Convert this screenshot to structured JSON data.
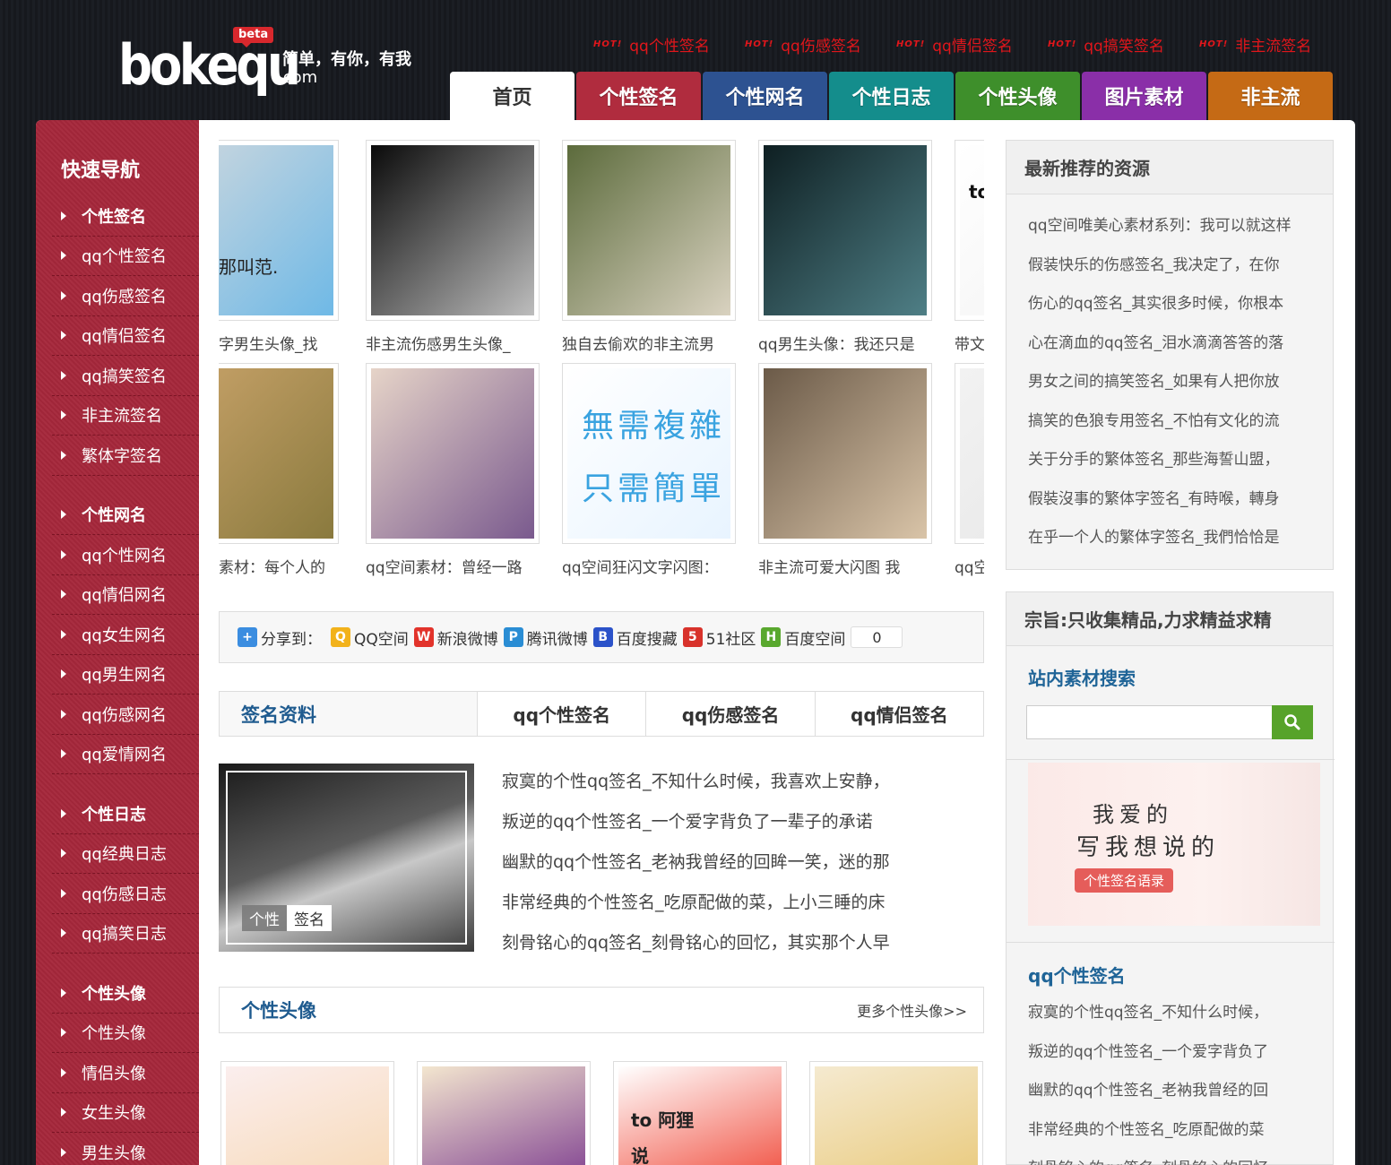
{
  "header": {
    "logo_text": "bokequ",
    "logo_badge": "beta",
    "logo_slogan": "简单，有你，有我",
    "logo_domain": ".com",
    "hot_badge": "HOT!",
    "hot_links": [
      "qq个性签名",
      "qq伤感签名",
      "qq情侣签名",
      "qq搞笑签名",
      "非主流签名"
    ]
  },
  "nav": {
    "tabs": [
      {
        "label": "首页",
        "color": "#ffffff"
      },
      {
        "label": "个性签名",
        "color": "#b02c3e"
      },
      {
        "label": "个性网名",
        "color": "#2d5291"
      },
      {
        "label": "个性日志",
        "color": "#148d8c"
      },
      {
        "label": "个性头像",
        "color": "#3e8f2b"
      },
      {
        "label": "图片素材",
        "color": "#8a2fa8"
      },
      {
        "label": "非主流",
        "color": "#c56a15"
      }
    ]
  },
  "sidebar": {
    "title": "快速导航",
    "groups": [
      {
        "head": "个性签名",
        "items": [
          "qq个性签名",
          "qq伤感签名",
          "qq情侣签名",
          "qq搞笑签名",
          "非主流签名",
          "繁体字签名"
        ]
      },
      {
        "head": "个性网名",
        "items": [
          "qq个性网名",
          "qq情侣网名",
          "qq女生网名",
          "qq男生网名",
          "qq伤感网名",
          "qq爱情网名"
        ]
      },
      {
        "head": "个性日志",
        "items": [
          "qq经典日志",
          "qq伤感日志",
          "qq搞笑日志"
        ]
      },
      {
        "head": "个性头像",
        "items": [
          "个性头像",
          "情侣头像",
          "女生头像",
          "男生头像"
        ]
      }
    ]
  },
  "gallery": {
    "row1": [
      {
        "caption": "字男生头像_找",
        "overlay": "二逼那叫范.",
        "color1": "#cfd8de",
        "color2": "#6fb9e6"
      },
      {
        "caption": "非主流伤感男生头像_",
        "color1": "#0a0a0a",
        "color2": "#bdbdbd"
      },
      {
        "caption": "独自去偷欢的非主流男",
        "color1": "#5c6b3c",
        "color2": "#d9d2c0"
      },
      {
        "caption": "qq男生头像：我还只是",
        "color1": "#0e1f22",
        "color2": "#4f7f86"
      },
      {
        "caption": "带文字",
        "overlay": "to",
        "color1": "#ffffff",
        "color2": "#f2f2f2"
      }
    ],
    "row2": [
      {
        "caption": "素材：每个人的",
        "color1": "#c9a36a",
        "color2": "#8a7a3e"
      },
      {
        "caption": "qq空间素材：曾经一路",
        "color1": "#e6d4c8",
        "color2": "#7a5a8e"
      },
      {
        "caption": "qq空间狂闪文字闪图：",
        "overlay": "無需複雜 只需簡單",
        "color1": "#ffffff",
        "color2": "#e8f4ff"
      },
      {
        "caption": "非主流可爱大闪图 我",
        "color1": "#6b5a48",
        "color2": "#d9c4a8"
      },
      {
        "caption": "qq空间",
        "color1": "#f2f2f2",
        "color2": "#e6e6e6"
      }
    ]
  },
  "share": {
    "label": "分享到：",
    "items": [
      {
        "name": "QQ空间",
        "icon": "qzone-icon",
        "color": "#f2b21b",
        "glyph": "Q"
      },
      {
        "name": "新浪微博",
        "icon": "weibo-icon",
        "color": "#e2332b",
        "glyph": "W"
      },
      {
        "name": "腾讯微博",
        "icon": "tencent-weibo-icon",
        "color": "#2a8dd4",
        "glyph": "P"
      },
      {
        "name": "百度搜藏",
        "icon": "baidu-icon",
        "color": "#2b52c9",
        "glyph": "B"
      },
      {
        "name": "51社区",
        "icon": "51-icon",
        "color": "#d8322b",
        "glyph": "5"
      },
      {
        "name": "百度空间",
        "icon": "baidu-space-icon",
        "color": "#59a82e",
        "glyph": "H"
      }
    ],
    "count": "0"
  },
  "sign_section": {
    "title": "签名资料",
    "tabs": [
      "qq个性签名",
      "qq伤感签名",
      "qq情侣签名"
    ],
    "image_tag_1": "个性",
    "image_tag_2": "签名",
    "lines": [
      "寂寞的个性qq签名_不知什么时候，我喜欢上安静，",
      "叛逆的qq个性签名_一个爱字背负了一辈子的承诺",
      "幽默的qq个性签名_老衲我曾经的回眸一笑，迷的那",
      "非常经典的个性签名_吃原配做的菜，上小三睡的床",
      "刻骨铭心的qq签名_刻骨铭心的回忆，其实那个人早"
    ]
  },
  "avatar_section": {
    "title": "个性头像",
    "more": "更多个性头像>>",
    "thumbs": [
      {
        "color1": "#fbeeee",
        "color2": "#f7d9b5"
      },
      {
        "color1": "#f3e6cf",
        "color2": "#7d3d8f"
      },
      {
        "color1": "#ffffff",
        "color2": "#f04a3a",
        "overlay": "to 阿狸说"
      },
      {
        "color1": "#f5ead0",
        "color2": "#e9c97a"
      }
    ]
  },
  "right": {
    "box1_title": "最新推荐的资源",
    "box1_lines": [
      "qq空间唯美心素材系列：我可以就这样",
      "假装快乐的伤感签名_我决定了，在你",
      "伤心的qq签名_其实很多时候，你根本",
      "心在滴血的qq签名_泪水滴滴答答的落",
      "男女之间的搞笑签名_如果有人把你放",
      "搞笑的色狼专用签名_不怕有文化的流",
      "关于分手的繁体签名_那些海誓山盟，",
      "假裝沒事的繁体字签名_有時喉，轉身",
      "在乎一个人的繁体字签名_我們恰恰是"
    ],
    "box2_title": "宗旨:只收集精品,力求精益求精",
    "search_title": "站内素材搜索",
    "search_placeholder": "",
    "banner_line1": "我爱的",
    "banner_line2": "写我想说的",
    "banner_badge": "个性签名语录",
    "sub_title": "qq个性签名",
    "sub_lines": [
      "寂寞的个性qq签名_不知什么时候，",
      "叛逆的qq个性签名_一个爱字背负了",
      "幽默的qq个性签名_老衲我曾经的回",
      "非常经典的个性签名_吃原配做的菜",
      "刻骨铭心的qq签名_刻骨铭心的回忆"
    ]
  }
}
